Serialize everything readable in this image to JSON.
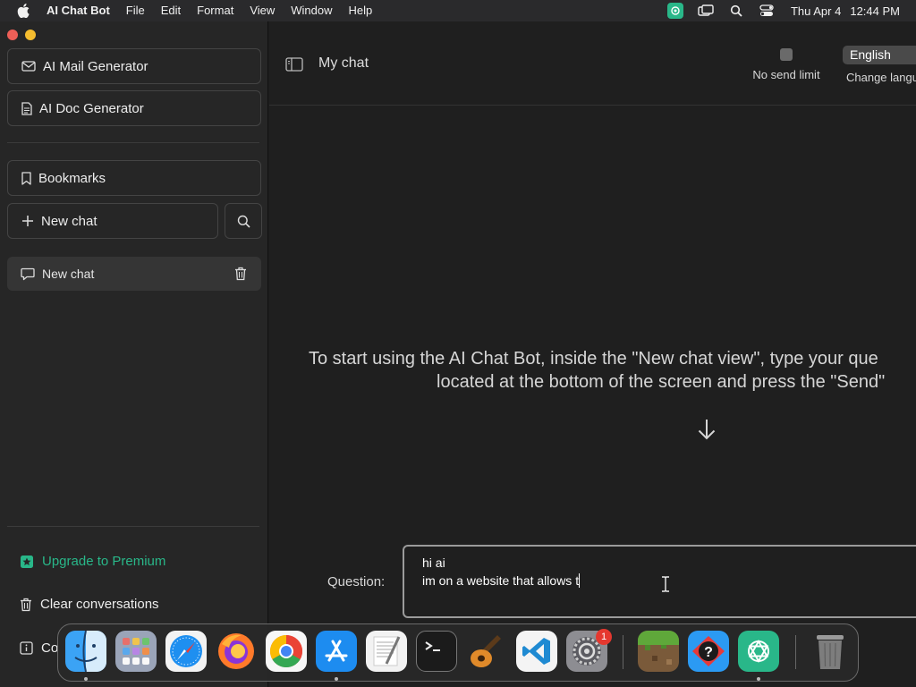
{
  "menubar": {
    "app_name": "AI Chat Bot",
    "items": [
      "File",
      "Edit",
      "Format",
      "View",
      "Window",
      "Help"
    ],
    "date": "Thu Apr 4",
    "time": "12:44 PM"
  },
  "sidebar": {
    "mail_generator": "AI Mail Generator",
    "doc_generator": "AI Doc Generator",
    "bookmarks": "Bookmarks",
    "new_chat": "New chat",
    "chats": [
      {
        "title": "New chat"
      }
    ],
    "upgrade": "Upgrade to Premium",
    "clear": "Clear conversations",
    "partial_item": "Co"
  },
  "header": {
    "title": "My chat",
    "no_send_limit": "No send limit",
    "language_value": "English",
    "language_label": "Change langu"
  },
  "main": {
    "instructions_line1": "To start using the AI Chat Bot, inside the \"New chat view\", type your que",
    "instructions_line2": "located at the bottom of the screen and press the \"Send\"",
    "question_label": "Question:",
    "question_line1": "hi ai",
    "question_line2": "im on a website that allows t"
  },
  "dock": {
    "apps": [
      "Finder",
      "Launchpad",
      "Safari",
      "Firefox",
      "Chrome",
      "App Store",
      "TextEdit",
      "Terminal",
      "GarageBand",
      "Visual Studio Code",
      "System Settings",
      "Minecraft",
      "Help",
      "AI Chat Bot",
      "Trash"
    ],
    "settings_badge": "1"
  },
  "colors": {
    "accent_green": "#29b789",
    "sidebar_bg": "#262626",
    "main_bg": "#1f1f1f",
    "close": "#ee5f57",
    "minimize": "#f5bd2f"
  }
}
